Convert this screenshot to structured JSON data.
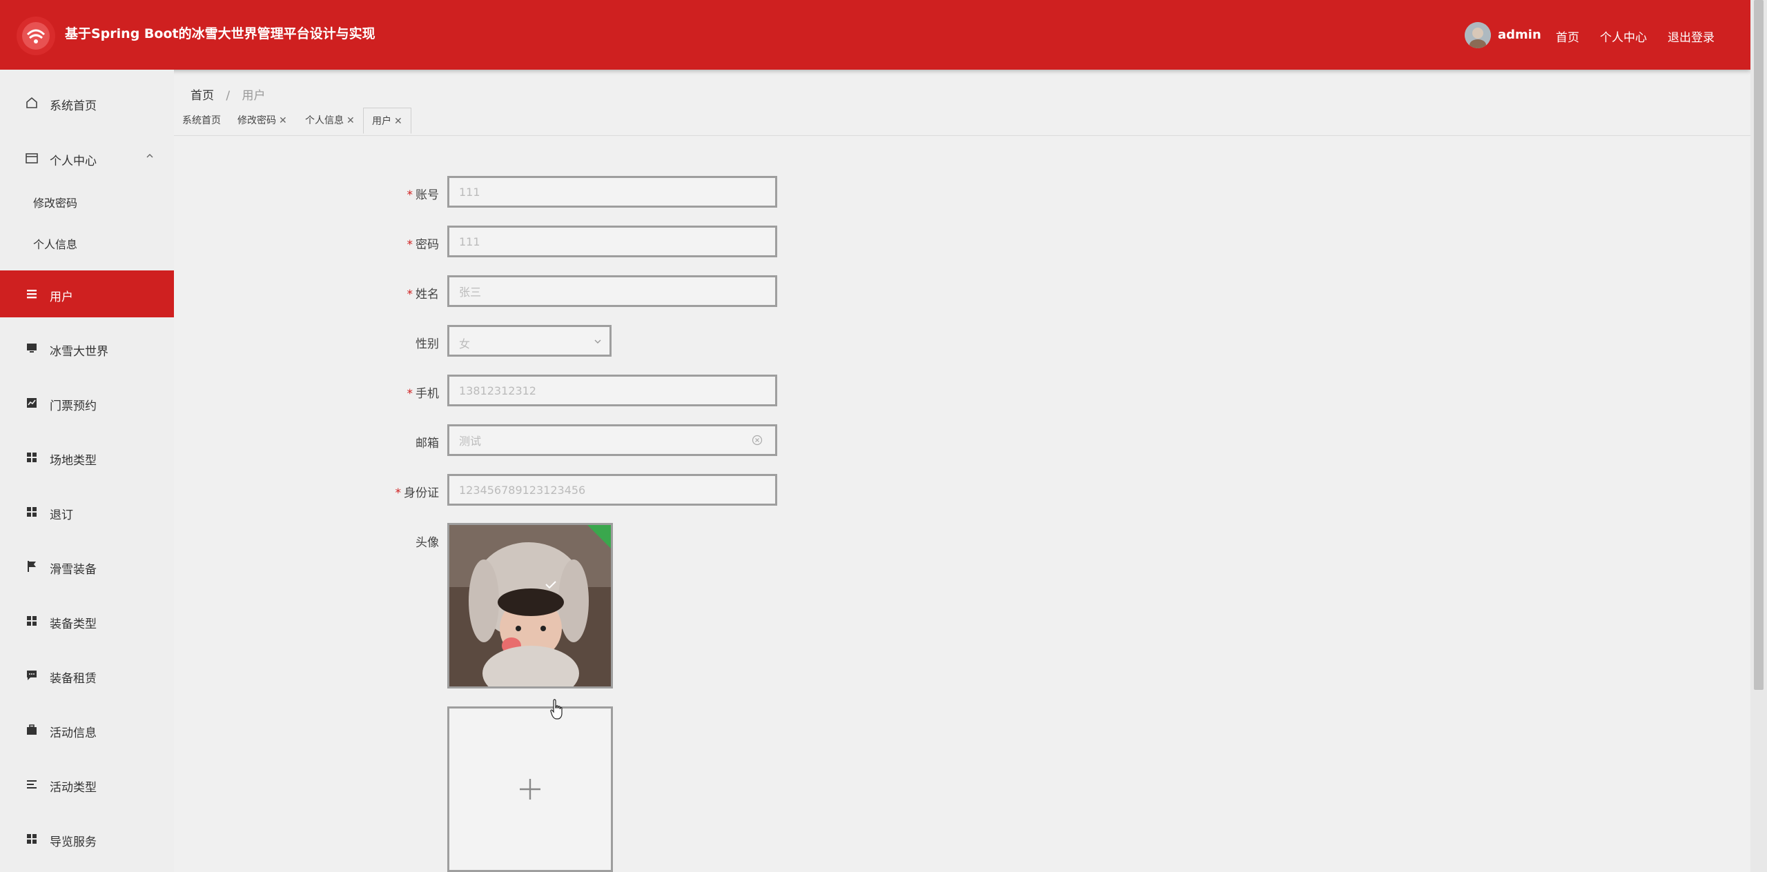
{
  "header": {
    "app_title": "基于Spring Boot的冰雪大世界管理平台设计与实现",
    "username": "admin",
    "nav": [
      "首页",
      "个人中心",
      "退出登录"
    ],
    "brand_color": "#cf2020"
  },
  "sidebar": {
    "items": [
      {
        "label": "系统首页",
        "icon": "home-icon"
      },
      {
        "label": "个人中心",
        "icon": "wallet-icon"
      },
      {
        "label": "用户",
        "icon": "list-icon"
      },
      {
        "label": "冰雪大世界",
        "icon": "monitor-icon"
      },
      {
        "label": "门票预约",
        "icon": "chart-icon"
      },
      {
        "label": "场地类型",
        "icon": "grid-icon"
      },
      {
        "label": "退订",
        "icon": "grid-icon"
      },
      {
        "label": "滑雪装备",
        "icon": "flag-icon"
      },
      {
        "label": "装备类型",
        "icon": "grid-icon"
      },
      {
        "label": "装备租赁",
        "icon": "message-icon"
      },
      {
        "label": "活动信息",
        "icon": "briefcase-icon"
      },
      {
        "label": "活动类型",
        "icon": "lines-icon"
      },
      {
        "label": "导览服务",
        "icon": "grid-icon"
      }
    ],
    "sub_items": [
      "修改密码",
      "个人信息"
    ],
    "active": "用户"
  },
  "breadcrumb": {
    "home": "首页",
    "sep": "/",
    "current": "用户"
  },
  "tabs": [
    {
      "label": "系统首页",
      "closable": false
    },
    {
      "label": "修改密码",
      "closable": true
    },
    {
      "label": "个人信息",
      "closable": true
    },
    {
      "label": "用户",
      "closable": true
    }
  ],
  "close_glyph": "✕",
  "form": {
    "account": {
      "label": "账号",
      "value": "111",
      "required": true
    },
    "password": {
      "label": "密码",
      "value": "111",
      "required": true
    },
    "name": {
      "label": "姓名",
      "value": "张三",
      "required": true
    },
    "gender": {
      "label": "性别",
      "value": "女",
      "required": false
    },
    "phone": {
      "label": "手机",
      "value": "13812312312",
      "required": true
    },
    "email": {
      "label": "邮箱",
      "value": "测试",
      "required": false
    },
    "id_card": {
      "label": "身份证",
      "value": "123456789123123456",
      "required": true
    },
    "avatar": {
      "label": "头像",
      "required": false
    },
    "required_mark": "*"
  }
}
